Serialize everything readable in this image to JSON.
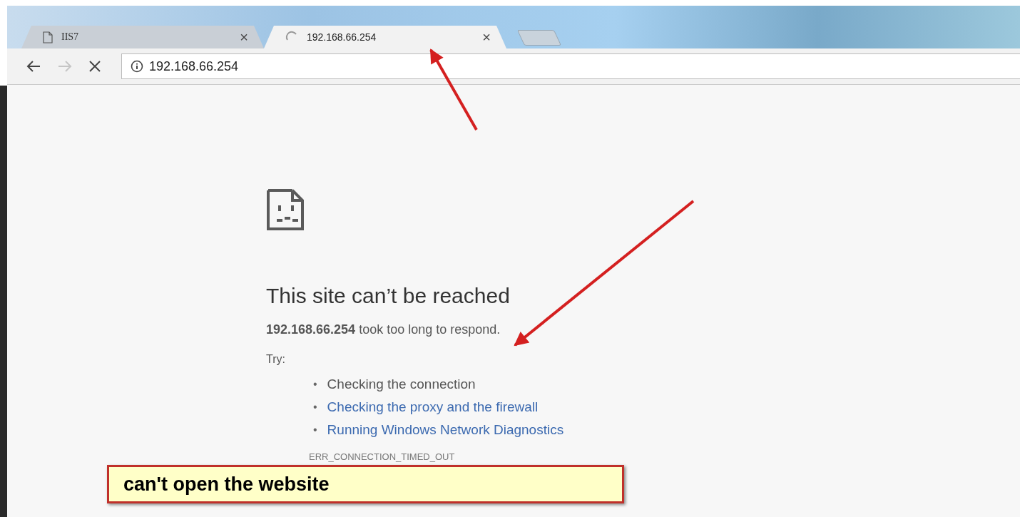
{
  "tabs": [
    {
      "title": "IIS7",
      "selected": false,
      "kind": "page",
      "close": "×"
    },
    {
      "title": "192.168.66.254",
      "selected": true,
      "kind": "loading",
      "close": "×"
    }
  ],
  "toolbar": {
    "buttons": [
      {
        "kind": "back",
        "disabled": false
      },
      {
        "kind": "forward",
        "disabled": true
      },
      {
        "kind": "stop",
        "disabled": false
      }
    ],
    "address": "192.168.66.254"
  },
  "error_page": {
    "heading": "This site can’t be reached",
    "message": "**192.168.66.254** took too long to respond.",
    "try_label": "Try:",
    "suggestions": [
      {
        "marker": "•",
        "text": "Checking the connection",
        "kind": "text"
      },
      {
        "marker": "•",
        "text": "Checking the proxy and the firewall",
        "kind": "link"
      },
      {
        "marker": "•",
        "text": "Running Windows Network Diagnostics",
        "kind": "link"
      }
    ],
    "error_code": "ERR_CONNECTION_TIMED_OUT"
  },
  "callout": "can't open the website"
}
